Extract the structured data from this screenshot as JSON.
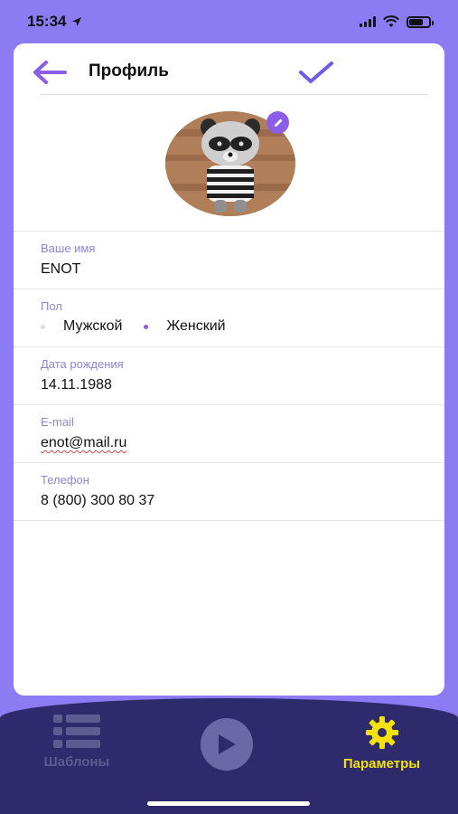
{
  "status_bar": {
    "time": "15:34",
    "icons": [
      "location-arrow-icon",
      "cellular-signal-icon",
      "wifi-icon",
      "battery-icon"
    ]
  },
  "header": {
    "title": "Профиль",
    "back_icon": "arrow-left-icon",
    "save_icon": "checkmark-icon"
  },
  "avatar": {
    "edit_icon": "pencil-icon"
  },
  "fields": {
    "name": {
      "label": "Ваше имя",
      "value": "ENOT"
    },
    "gender": {
      "label": "Пол",
      "options": [
        "Мужской",
        "Женский"
      ],
      "selected": "Женский"
    },
    "birthdate": {
      "label": "Дата рождения",
      "value": "14.11.1988"
    },
    "email": {
      "label": "E-mail",
      "value": "enot@mail.ru"
    },
    "phone": {
      "label": "Телефон",
      "value": "8 (800) 300 80 37"
    }
  },
  "tabbar": {
    "items": [
      {
        "label": "Шаблоны",
        "icon": "list-icon",
        "active": false
      },
      {
        "label": "",
        "icon": "play-icon",
        "active": false
      },
      {
        "label": "Параметры",
        "icon": "gear-icon",
        "active": true
      }
    ]
  },
  "colors": {
    "background": "#8c7bf3",
    "accent": "#8c5de8",
    "label": "#8a86d6",
    "tabbar": "#2e2a6b",
    "active_tab": "#f2e10c",
    "inactive_tab": "#5e5a92"
  }
}
